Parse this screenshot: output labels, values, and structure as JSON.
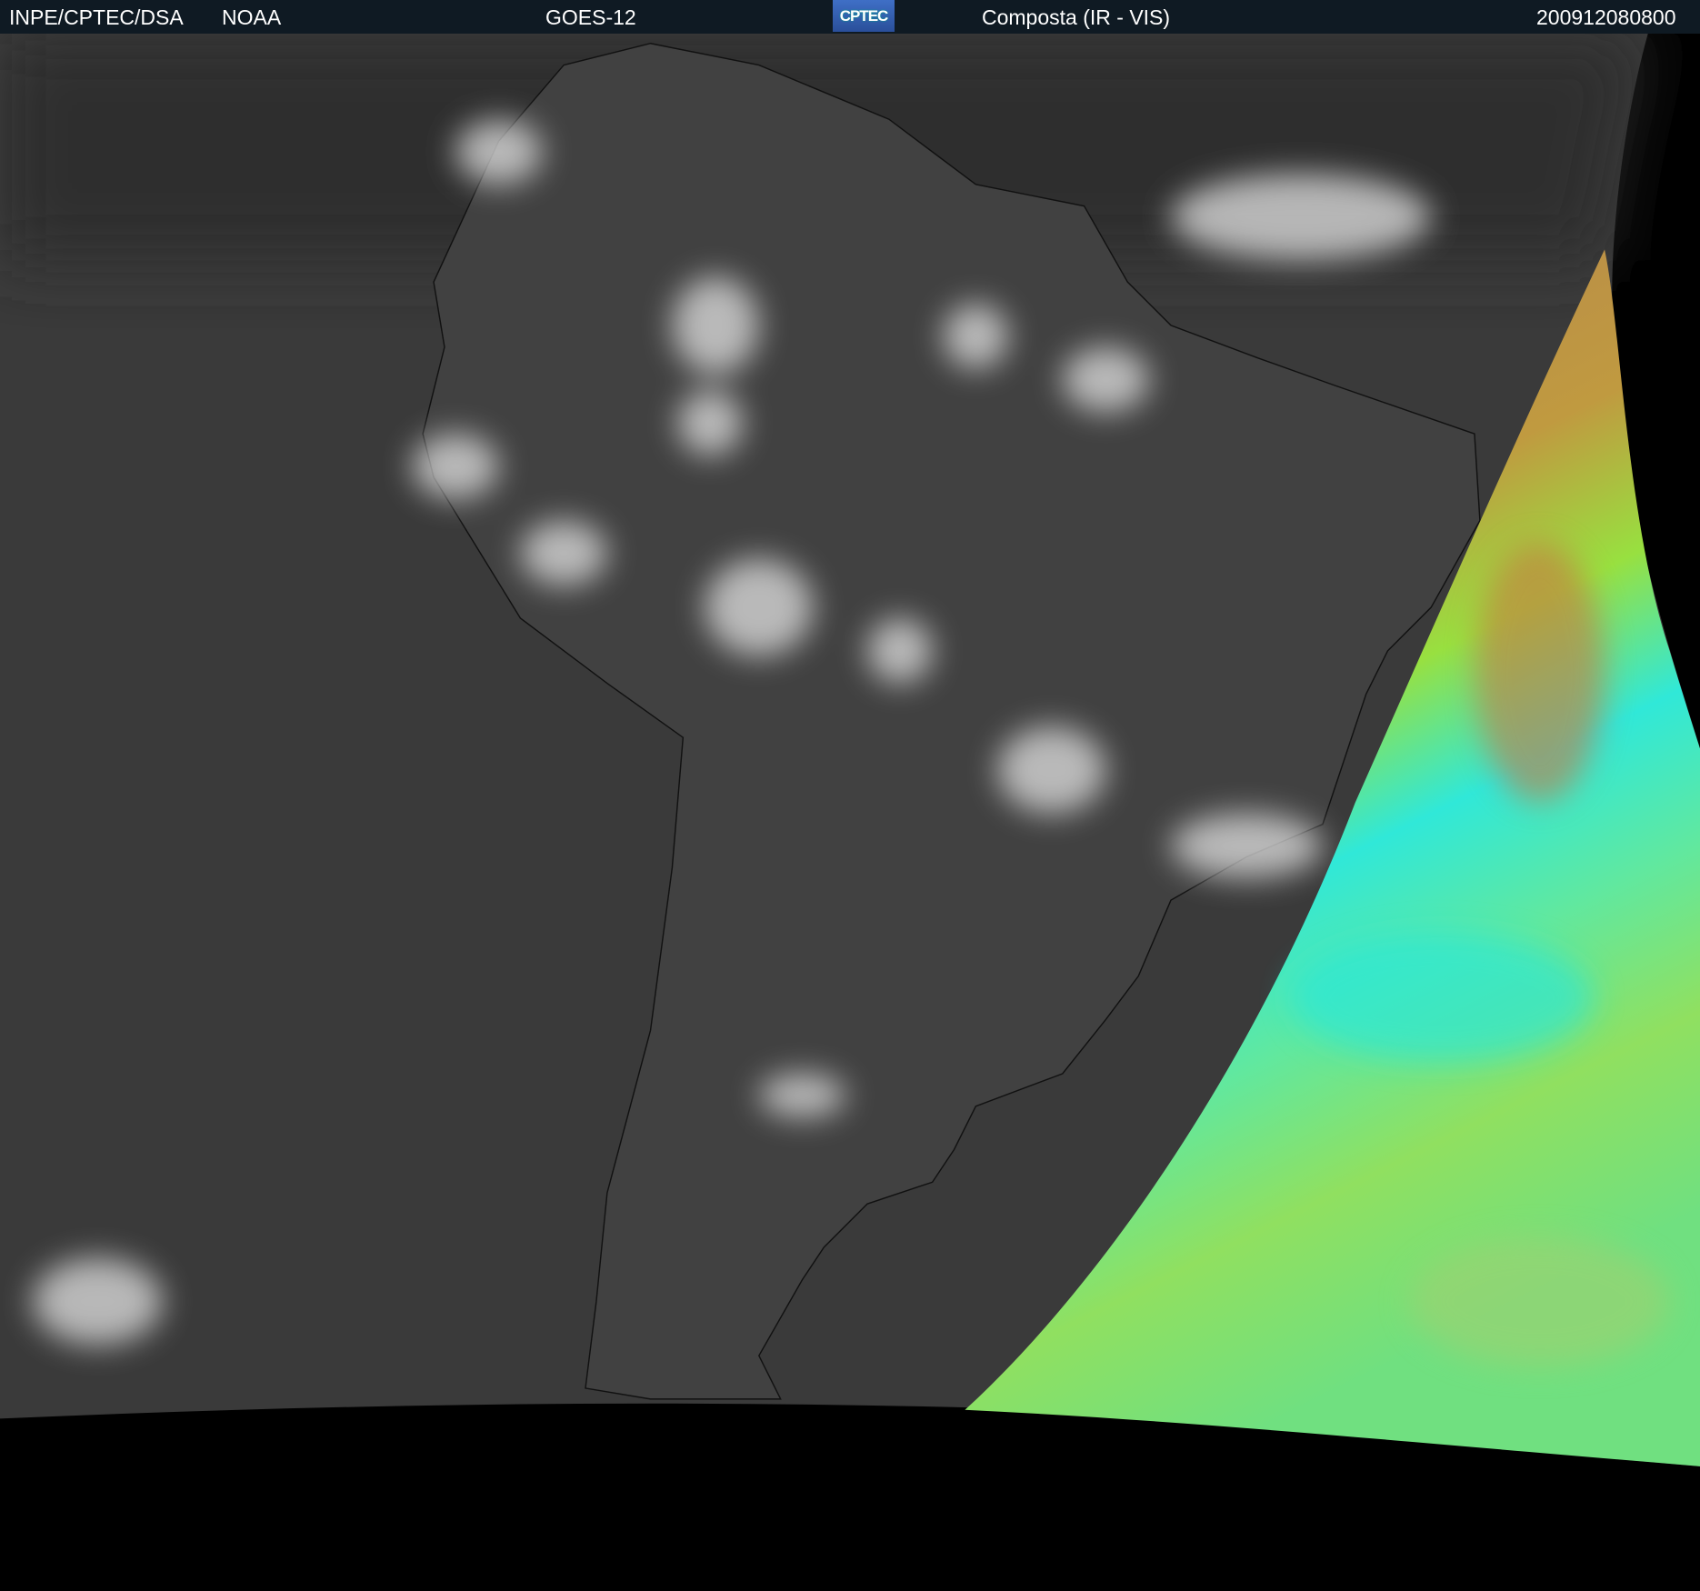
{
  "header": {
    "agency": "INPE/CPTEC/DSA",
    "partner": "NOAA",
    "satellite": "GOES-12",
    "logo_text": "CPTEC",
    "product": "Composta (IR - VIS)",
    "timestamp": "200912080800"
  }
}
